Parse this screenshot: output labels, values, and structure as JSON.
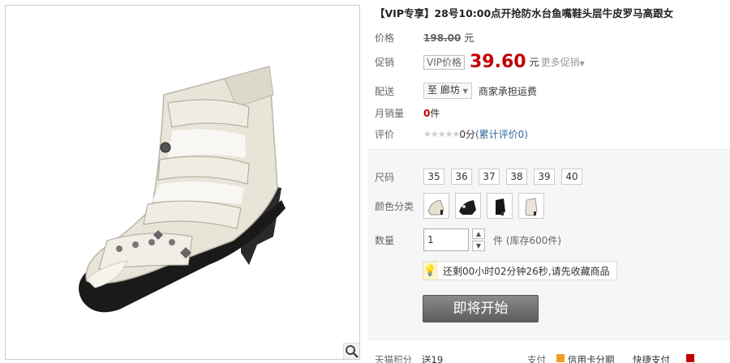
{
  "product": {
    "title": "【VIP专享】28号10:00点开抢防水台鱼嘴鞋头层牛皮罗马高跟女"
  },
  "price": {
    "label": "价格",
    "original": "198.00",
    "unit": "元"
  },
  "promo": {
    "label": "促销",
    "tag": "VIP价格",
    "price": "39.60",
    "unit": "元",
    "more_link": "更多促销"
  },
  "delivery": {
    "label": "配送",
    "location": "至 廊坊",
    "note": "商家承担运费"
  },
  "sales": {
    "label": "月销量",
    "count": "0",
    "unit": "件"
  },
  "rating": {
    "label": "评价",
    "stars": "★★★★★",
    "score_text": "0分",
    "link": "(累计评价0)"
  },
  "sku": {
    "size_label": "尺码",
    "sizes": [
      "35",
      "36",
      "37",
      "38",
      "39",
      "40"
    ],
    "color_label": "颜色分类",
    "colors": [
      "beige-sandal",
      "black-sandal",
      "black-boot",
      "beige-heel"
    ],
    "qty_label": "数量",
    "qty_value": "1",
    "qty_unit": "件",
    "stock": "(库存600件)"
  },
  "countdown": {
    "text": "还剩00小时02分钟26秒,请先收藏商品"
  },
  "buy": {
    "label": "即将开始"
  },
  "bottom": {
    "points_label": "天猫积分",
    "points_value": "送19",
    "pay_label": "支付",
    "credit": "信用卡分期",
    "express": "快捷支付"
  },
  "colors": {
    "accent_red": "#c40000",
    "link_blue": "#336699",
    "panel_bg": "#f6f6f6",
    "button_gray": "#666666"
  }
}
